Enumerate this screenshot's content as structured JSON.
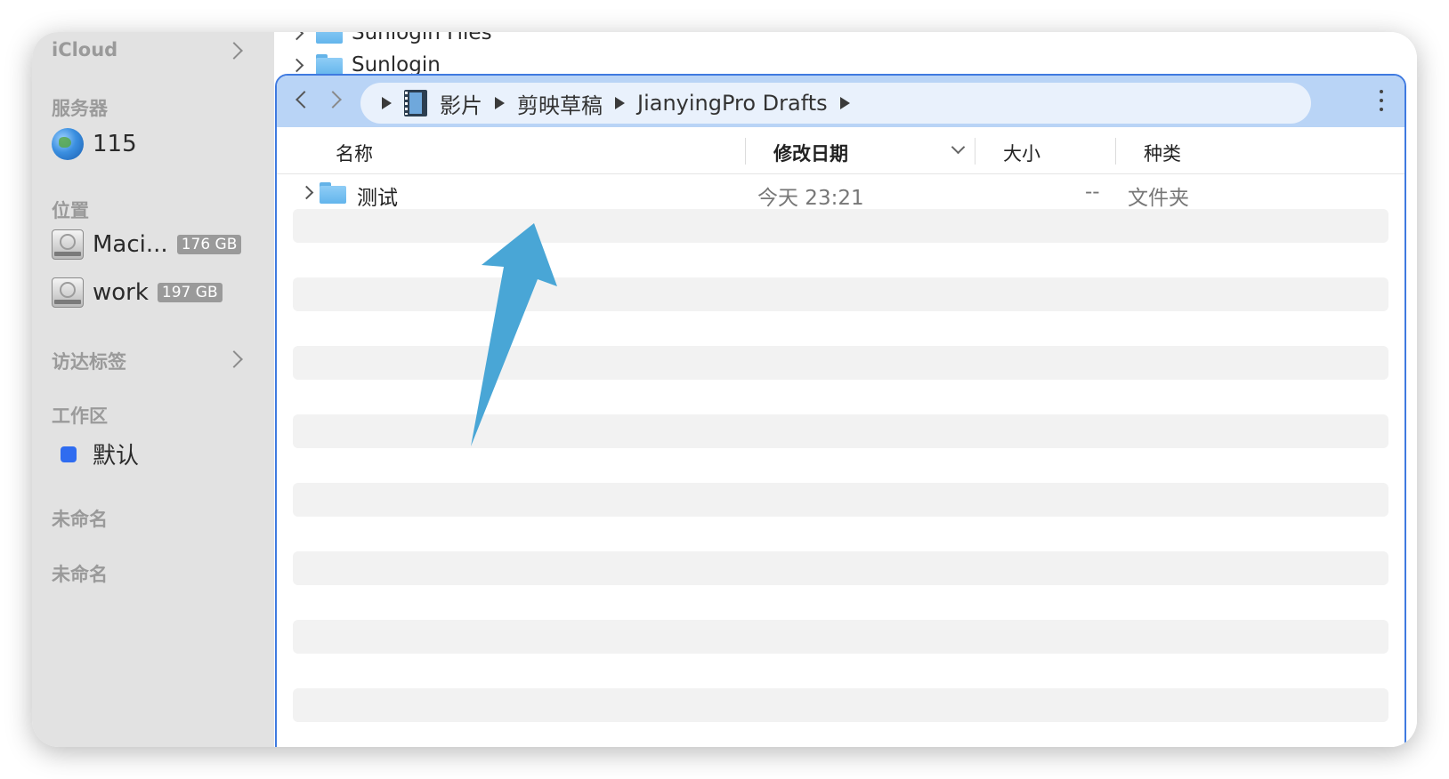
{
  "sidebar": {
    "icloud_label": "iCloud",
    "server_section": "服务器",
    "server_items": [
      {
        "label": "115",
        "icon": "globe-icon"
      }
    ],
    "location_section": "位置",
    "location_items": [
      {
        "label": "Maci...",
        "badge": "176 GB",
        "icon": "disk-icon"
      },
      {
        "label": "work",
        "badge": "197 GB",
        "icon": "disk-icon"
      }
    ],
    "tags_section": "访达标签",
    "workspace_section": "工作区",
    "workspace_items": [
      {
        "label": "默认",
        "color": "#2f6cf0"
      }
    ],
    "unnamed_1": "未命名",
    "unnamed_2": "未命名"
  },
  "top_stub": {
    "rows": [
      "Sunlogin Files",
      "Sunlogin"
    ]
  },
  "pathbar": {
    "crumbs": [
      "影片",
      "剪映草稿",
      "JianyingPro Drafts"
    ]
  },
  "columns": {
    "name": "名称",
    "modified": "修改日期",
    "size": "大小",
    "kind": "种类"
  },
  "files": [
    {
      "name": "测试",
      "modified": "今天 23:21",
      "size": "--",
      "kind": "文件夹"
    }
  ],
  "colors": {
    "selection_border": "#3f7ae0",
    "pathbar_bg": "#b9d4f6",
    "annotation_arrow": "#49a6d6"
  }
}
